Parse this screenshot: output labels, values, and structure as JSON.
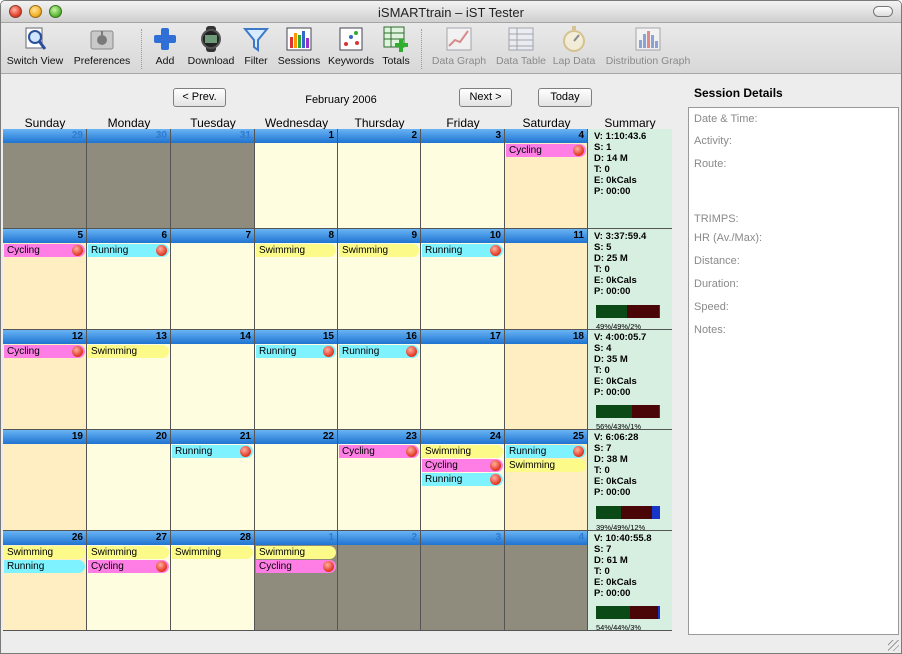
{
  "window": {
    "title": "iSMARTtrain – iST Tester"
  },
  "toolbar": [
    {
      "label": "Switch View",
      "icon": "magnifier-doc-icon",
      "enabled": true
    },
    {
      "label": "Preferences",
      "icon": "apple-icon",
      "enabled": true
    },
    {
      "label": "Add",
      "icon": "plus-icon",
      "enabled": true
    },
    {
      "label": "Download",
      "icon": "watch-icon",
      "enabled": true
    },
    {
      "label": "Filter",
      "icon": "funnel-icon",
      "enabled": true
    },
    {
      "label": "Sessions",
      "icon": "bar-chart-icon",
      "enabled": true
    },
    {
      "label": "Keywords",
      "icon": "dice-icon",
      "enabled": true
    },
    {
      "label": "Totals",
      "icon": "table-plus-icon",
      "enabled": true
    },
    {
      "label": "Data Graph",
      "icon": "line-graph-icon",
      "enabled": false
    },
    {
      "label": "Data Table",
      "icon": "table-icon",
      "enabled": false
    },
    {
      "label": "Lap Data",
      "icon": "stopwatch-icon",
      "enabled": false
    },
    {
      "label": "Distribution Graph",
      "icon": "distribution-icon",
      "enabled": false
    }
  ],
  "nav": {
    "prev": "< Prev.",
    "month": "February 2006",
    "next": "Next >",
    "today": "Today"
  },
  "day_headers": [
    "Sunday",
    "Monday",
    "Tuesday",
    "Wednesday",
    "Thursday",
    "Friday",
    "Saturday",
    "Summary"
  ],
  "weeks": [
    {
      "days": [
        {
          "num": "29",
          "out": true,
          "events": []
        },
        {
          "num": "30",
          "out": true,
          "events": []
        },
        {
          "num": "31",
          "out": true,
          "events": []
        },
        {
          "num": "1",
          "out": false,
          "events": []
        },
        {
          "num": "2",
          "out": false,
          "events": []
        },
        {
          "num": "3",
          "out": false,
          "events": []
        },
        {
          "num": "4",
          "out": false,
          "events": [
            {
              "label": "Cycling",
              "type": "cycling",
              "heart": true
            }
          ]
        }
      ],
      "summary": {
        "lines": [
          "V: 1:10:43.6",
          "S: 1",
          "D: 14 M",
          "T: 0",
          "E: 0kCals",
          "P: 00:00"
        ],
        "zones": null
      }
    },
    {
      "days": [
        {
          "num": "5",
          "out": false,
          "events": [
            {
              "label": "Cycling",
              "type": "cycling",
              "heart": true
            }
          ]
        },
        {
          "num": "6",
          "out": false,
          "events": [
            {
              "label": "Running",
              "type": "running",
              "heart": true
            }
          ]
        },
        {
          "num": "7",
          "out": false,
          "events": []
        },
        {
          "num": "8",
          "out": false,
          "events": [
            {
              "label": "Swimming",
              "type": "swimming",
              "heart": false
            }
          ]
        },
        {
          "num": "9",
          "out": false,
          "events": [
            {
              "label": "Swimming",
              "type": "swimming",
              "heart": false
            }
          ]
        },
        {
          "num": "10",
          "out": false,
          "events": [
            {
              "label": "Running",
              "type": "running",
              "heart": true
            }
          ]
        },
        {
          "num": "11",
          "out": false,
          "events": []
        }
      ],
      "summary": {
        "lines": [
          "V: 3:37:59.4",
          "S: 5",
          "D: 25 M",
          "T: 0",
          "E: 0kCals",
          "P: 00:00"
        ],
        "zones": {
          "label": "49%/49%/2%",
          "values": [
            49,
            49,
            2
          ]
        }
      }
    },
    {
      "days": [
        {
          "num": "12",
          "out": false,
          "events": [
            {
              "label": "Cycling",
              "type": "cycling",
              "heart": true
            }
          ]
        },
        {
          "num": "13",
          "out": false,
          "events": [
            {
              "label": "Swimming",
              "type": "swimming",
              "heart": false
            }
          ]
        },
        {
          "num": "14",
          "out": false,
          "events": []
        },
        {
          "num": "15",
          "out": false,
          "events": [
            {
              "label": "Running",
              "type": "running",
              "heart": true
            }
          ]
        },
        {
          "num": "16",
          "out": false,
          "events": [
            {
              "label": "Running",
              "type": "running",
              "heart": true
            }
          ]
        },
        {
          "num": "17",
          "out": false,
          "events": []
        },
        {
          "num": "18",
          "out": false,
          "events": []
        }
      ],
      "summary": {
        "lines": [
          "V: 4:00:05.7",
          "S: 4",
          "D: 35 M",
          "T: 0",
          "E: 0kCals",
          "P: 00:00"
        ],
        "zones": {
          "label": "56%/43%/1%",
          "values": [
            56,
            43,
            1
          ]
        }
      }
    },
    {
      "days": [
        {
          "num": "19",
          "out": false,
          "events": []
        },
        {
          "num": "20",
          "out": false,
          "events": []
        },
        {
          "num": "21",
          "out": false,
          "events": [
            {
              "label": "Running",
              "type": "running",
              "heart": true
            }
          ]
        },
        {
          "num": "22",
          "out": false,
          "events": []
        },
        {
          "num": "23",
          "out": false,
          "events": [
            {
              "label": "Cycling",
              "type": "cycling",
              "heart": true
            }
          ]
        },
        {
          "num": "24",
          "out": false,
          "events": [
            {
              "label": "Swimming",
              "type": "swimming",
              "heart": false
            },
            {
              "label": "Cycling",
              "type": "cycling",
              "heart": true
            },
            {
              "label": "Running",
              "type": "running",
              "heart": true
            }
          ]
        },
        {
          "num": "25",
          "out": false,
          "events": [
            {
              "label": "Running",
              "type": "running",
              "heart": true
            },
            {
              "label": "Swimming",
              "type": "swimming",
              "heart": false
            }
          ]
        }
      ],
      "summary": {
        "lines": [
          "V: 6:06:28",
          "S: 7",
          "D: 38 M",
          "T: 0",
          "E: 0kCals",
          "P: 00:00"
        ],
        "zones": {
          "label": "39%/49%/12%",
          "values": [
            39,
            49,
            12
          ]
        }
      }
    },
    {
      "days": [
        {
          "num": "26",
          "out": false,
          "events": [
            {
              "label": "Swimming",
              "type": "swimming",
              "heart": false
            },
            {
              "label": "Running",
              "type": "running",
              "heart": false
            }
          ]
        },
        {
          "num": "27",
          "out": false,
          "events": [
            {
              "label": "Swimming",
              "type": "swimming",
              "heart": false
            },
            {
              "label": "Cycling",
              "type": "cycling",
              "heart": true
            }
          ]
        },
        {
          "num": "28",
          "out": false,
          "events": [
            {
              "label": "Swimming",
              "type": "swimming",
              "heart": false
            }
          ]
        },
        {
          "num": "1",
          "out": true,
          "events": [
            {
              "label": "Swimming",
              "type": "swimming",
              "heart": false
            },
            {
              "label": "Cycling",
              "type": "cycling",
              "heart": true
            }
          ]
        },
        {
          "num": "2",
          "out": true,
          "events": []
        },
        {
          "num": "3",
          "out": true,
          "events": []
        },
        {
          "num": "4",
          "out": true,
          "events": []
        }
      ],
      "summary": {
        "lines": [
          "V: 10:40:55.8",
          "S: 7",
          "D: 61 M",
          "T: 0",
          "E: 0kCals",
          "P: 00:00"
        ],
        "zones": {
          "label": "54%/44%/3%",
          "values": [
            54,
            44,
            3
          ]
        }
      }
    }
  ],
  "zone_colors": [
    "#0b4a17",
    "#4a0606",
    "#1736c9"
  ],
  "details": {
    "title": "Session Details",
    "labels": [
      "Date & Time:",
      "Activity:",
      "Route:",
      "TRIMPS:",
      "HR (Av./Max):",
      "Distance:",
      "Duration:",
      "Speed:",
      "Notes:"
    ]
  }
}
